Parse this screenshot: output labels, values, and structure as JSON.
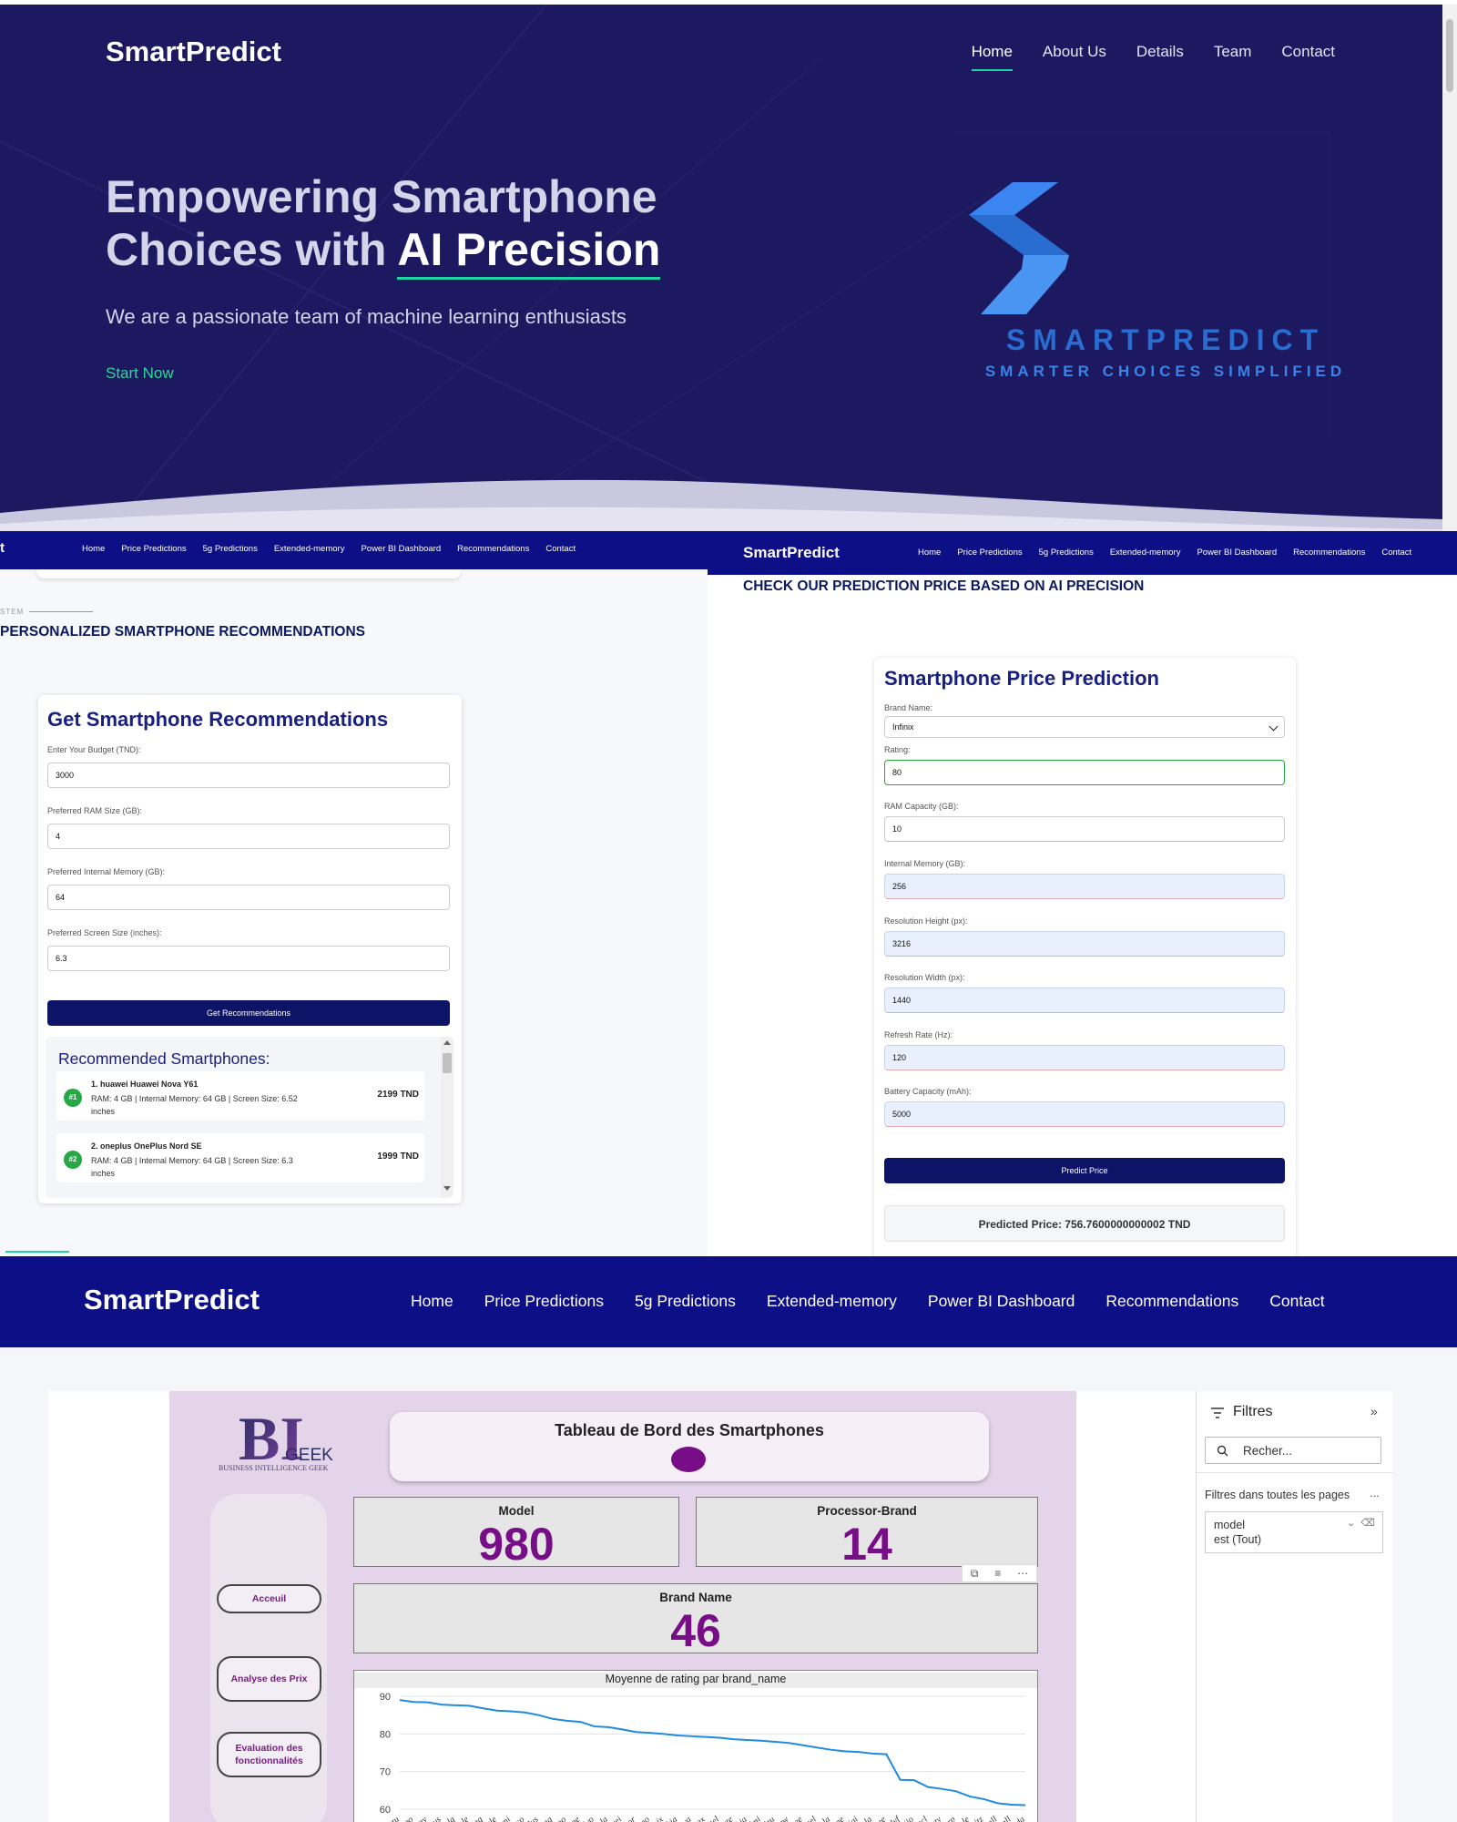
{
  "hero": {
    "brand": "SmartPredict",
    "nav": [
      "Home",
      "About Us",
      "Details",
      "Team",
      "Contact"
    ],
    "title_line1": "Empowering Smartphone",
    "title_line2_pre": "Choices with ",
    "title_line2_highlight": "AI Precision",
    "subtitle": "We are a passionate team of machine learning enthusiasts",
    "cta": "Start Now",
    "logo_word": "SMARTPREDICT",
    "logo_tagline": "SMARTER CHOICES SIMPLIFIED"
  },
  "left_panel": {
    "brand_fragment": "t",
    "nav": [
      "Home",
      "Price Predictions",
      "5g Predictions",
      "Extended-memory",
      "Power BI Dashboard",
      "Recommendations",
      "Contact"
    ],
    "kicker": "STEM",
    "heading": "PERSONALIZED SMARTPHONE RECOMMENDATIONS",
    "form": {
      "title": "Get Smartphone Recommendations",
      "budget_label": "Enter Your Budget (TND):",
      "budget_value": "3000",
      "ram_label": "Preferred RAM Size (GB):",
      "ram_value": "4",
      "memory_label": "Preferred Internal Memory (GB):",
      "memory_value": "64",
      "screen_label": "Preferred Screen Size (inches):",
      "screen_value": "6.3",
      "button": "Get Recommendations"
    },
    "results": {
      "title": "Recommended Smartphones:",
      "items": [
        {
          "badge": "#1",
          "name": "1. huawei Huawei Nova Y61",
          "spec": "RAM: 4 GB | Internal Memory: 64 GB | Screen Size: 6.52 inches",
          "price": "2199 TND"
        },
        {
          "badge": "#2",
          "name": "2. oneplus OnePlus Nord SE",
          "spec": "RAM: 4 GB | Internal Memory: 64 GB | Screen Size: 6.3 inches",
          "price": "1999 TND"
        }
      ]
    }
  },
  "right_panel": {
    "brand": "SmartPredict",
    "nav": [
      "Home",
      "Price Predictions",
      "5g Predictions",
      "Extended-memory",
      "Power BI Dashboard",
      "Recommendations",
      "Contact"
    ],
    "heading": "CHECK OUR PREDICTION PRICE BASED ON AI PRECISION",
    "form": {
      "title": "Smartphone Price Prediction",
      "brand_label": "Brand Name:",
      "brand_value": "Infinix",
      "rating_label": "Rating:",
      "rating_value": "80",
      "ram_label": "RAM Capacity (GB):",
      "ram_value": "10",
      "memory_label": "Internal Memory (GB):",
      "memory_value": "256",
      "res_h_label": "Resolution Height (px):",
      "res_h_value": "3216",
      "res_w_label": "Resolution Width (px):",
      "res_w_value": "1440",
      "refresh_label": "Refresh Rate (Hz):",
      "refresh_value": "120",
      "battery_label": "Battery Capacity (mAh):",
      "battery_value": "5000",
      "button": "Predict Price",
      "result": "Predicted Price: 756.7600000000002 TND"
    }
  },
  "dashboard_nav": {
    "brand": "SmartPredict",
    "nav": [
      "Home",
      "Price Predictions",
      "5g Predictions",
      "Extended-memory",
      "Power BI Dashboard",
      "Recommendations",
      "Contact"
    ]
  },
  "dashboard": {
    "logo_bi": "BI",
    "logo_geek": "GEEK",
    "logo_sub": "BUSINESS INTELLIGENCE GEEK",
    "title": "Tableau de Bord des Smartphones",
    "side_buttons": [
      "Acceuil",
      "Analyse des Prix",
      "Evaluation des fonctionnalités"
    ],
    "kpis": [
      {
        "label": "Model",
        "value": "980"
      },
      {
        "label": "Processor-Brand",
        "value": "14"
      },
      {
        "label": "Brand Name",
        "value": "46"
      }
    ],
    "accent_color": "#780e87",
    "chart_data": {
      "type": "line",
      "title": "Moyenne de rating par brand_name",
      "ylim": [
        60,
        90
      ],
      "yticks": [
        60,
        70,
        80,
        90
      ],
      "x": [
        "vertu",
        "oppo",
        "sony",
        "asus",
        "lg",
        "apple",
        "nothing",
        "google",
        "xiaomi",
        "poco",
        "oneplus",
        "samsung",
        "iqoo",
        "realme",
        "vivo",
        "motorola",
        "huawei",
        "honor",
        "tecno",
        "infinix",
        "nokia",
        "lava",
        "micromax",
        "itel",
        "zte",
        "nubia",
        "redmi",
        "meizu",
        "blackview",
        "doogee",
        "oukitel",
        "cola",
        "ulefone",
        "umidigi",
        "tesla",
        "gionee",
        "lyf",
        "jio",
        "tcl",
        "letv",
        "sharp",
        "royole",
        "leitz",
        "ikall",
        "iball",
        "kechaoda"
      ],
      "series": [
        {
          "values": [
            89,
            88.5,
            88.4,
            87.8,
            87.6,
            87.5,
            86.8,
            86.2,
            86,
            85.7,
            85,
            84,
            83.5,
            83.2,
            82,
            81.8,
            81.2,
            80.5,
            80.3,
            80,
            79.6,
            79.4,
            79.2,
            79,
            78.6,
            78.4,
            78.2,
            77.9,
            77.6,
            77,
            76.4,
            75.8,
            75.4,
            75.2,
            74.8,
            74.6,
            67.8,
            67.7,
            65.9,
            65.4,
            64.8,
            63.4,
            62.7,
            61.6,
            61.2,
            61.1
          ]
        }
      ]
    }
  },
  "filters": {
    "title": "Filtres",
    "search_placeholder": "Recher...",
    "section": "Filtres dans toutes les pages",
    "more": "...",
    "card_field": "model",
    "card_value": "est (Tout)"
  }
}
